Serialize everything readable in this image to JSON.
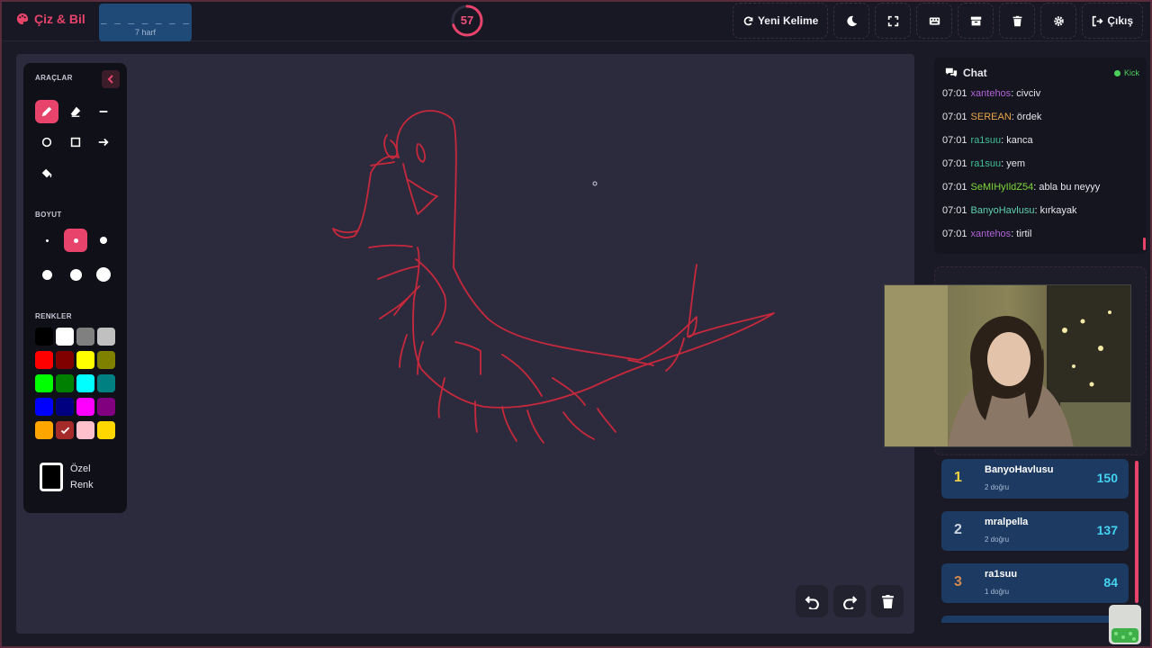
{
  "app": {
    "title": "Çiz & Bil"
  },
  "word": {
    "pattern": "_ _ _ _ _ _ _",
    "hint": "7 harf"
  },
  "timer": {
    "value": "57",
    "fraction_remaining": 0.7
  },
  "toolbar": {
    "new_word": "Yeni Kelime",
    "logout": "Çıkış",
    "icons": [
      "moon-icon",
      "fullscreen-icon",
      "keyboard-icon",
      "archive-icon",
      "trash-icon",
      "gear-icon"
    ]
  },
  "tools": {
    "title": "ARAÇLAR",
    "items": [
      "pen",
      "eraser",
      "line",
      "circle",
      "rectangle",
      "arrow",
      "fill"
    ],
    "active": "pen"
  },
  "size": {
    "label": "BOYUT",
    "options": 6,
    "active_index": 1
  },
  "colors": {
    "label": "RENKLER",
    "swatches": [
      "#000000",
      "#ffffff",
      "#808080",
      "#c0c0c0",
      "#ff0000",
      "#800000",
      "#ffff00",
      "#808000",
      "#00ff00",
      "#008000",
      "#00ffff",
      "#008080",
      "#0000ff",
      "#000080",
      "#ff00ff",
      "#800080",
      "#ffa500",
      "#a52a2a",
      "#ffc0cb",
      "#ffd700"
    ],
    "selected": "#a52a2a",
    "stroke_color": "#c8283c",
    "custom_label_1": "Özel",
    "custom_label_2": "Renk"
  },
  "chat": {
    "title": "Chat",
    "platform": "Kick",
    "messages": [
      {
        "time": "07:01",
        "user": "xantehos",
        "color": "#b063d8",
        "text": ": civciv"
      },
      {
        "time": "07:01",
        "user": "SEREAN",
        "color": "#e8a64c",
        "text": ": ördek"
      },
      {
        "time": "07:01",
        "user": "ra1suu",
        "color": "#3fbf95",
        "text": ": kanca"
      },
      {
        "time": "07:01",
        "user": "ra1suu",
        "color": "#3fbf95",
        "text": ": yem"
      },
      {
        "time": "07:01",
        "user": "SeMIHyIldZ54",
        "color": "#7fd83a",
        "text": ": abla bu neyyy"
      },
      {
        "time": "07:01",
        "user": "BanyoHavlusu",
        "color": "#5fd0b0",
        "text": ": kırkayak"
      },
      {
        "time": "07:01",
        "user": "xantehos",
        "color": "#b063d8",
        "text": ": tirtil"
      }
    ]
  },
  "leaderboard": [
    {
      "rank": "1",
      "name": "BanyoHavlusu",
      "correct": "2 doğru",
      "score": "150",
      "rank_color": "#f5d442"
    },
    {
      "rank": "2",
      "name": "mralpella",
      "correct": "2 doğru",
      "score": "137",
      "rank_color": "#cfd6e0"
    },
    {
      "rank": "3",
      "name": "ra1suu",
      "correct": "1 doğru",
      "score": "84",
      "rank_color": "#d58a4a"
    }
  ]
}
